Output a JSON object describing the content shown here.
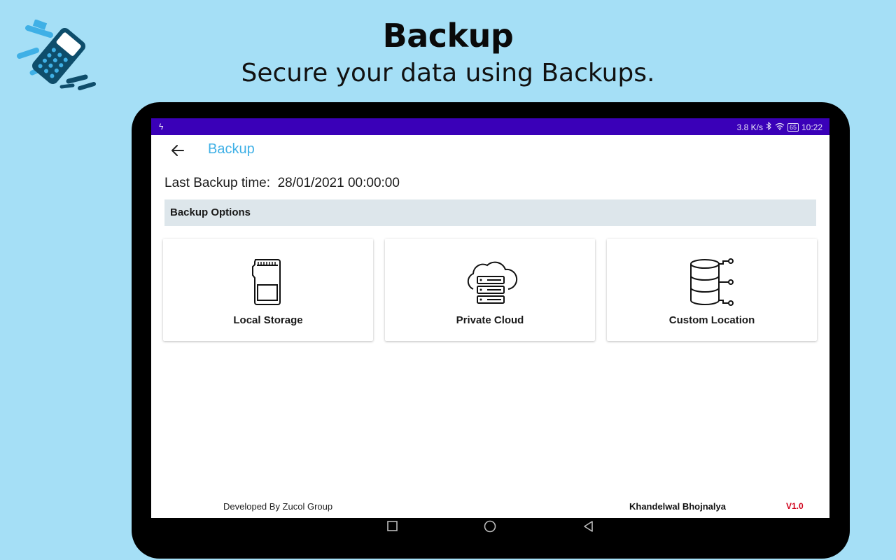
{
  "promo": {
    "title": "Backup",
    "subtitle": "Secure your data using Backups."
  },
  "status_bar": {
    "speed": "3.8 K/s",
    "battery": "65",
    "time": "10:22",
    "background": "#3a00b8"
  },
  "app_bar": {
    "title": "Backup",
    "back_icon": "arrow-left-icon",
    "title_color": "#3fb0e6"
  },
  "last_backup": {
    "label": "Last Backup time:",
    "value": "28/01/2021 00:00:00"
  },
  "section_header": "Backup Options",
  "options": [
    {
      "label": "Local Storage",
      "icon": "sd-card-icon"
    },
    {
      "label": "Private Cloud",
      "icon": "cloud-server-icon"
    },
    {
      "label": "Custom Location",
      "icon": "database-icon"
    }
  ],
  "footer": {
    "developer": "Developed By Zucol Group",
    "business_name": "Khandelwal Bhojnalya",
    "version": "V1.0",
    "version_color": "#d0021b"
  },
  "nav_bar": [
    "square-recents-icon",
    "circle-home-icon",
    "triangle-back-icon"
  ]
}
